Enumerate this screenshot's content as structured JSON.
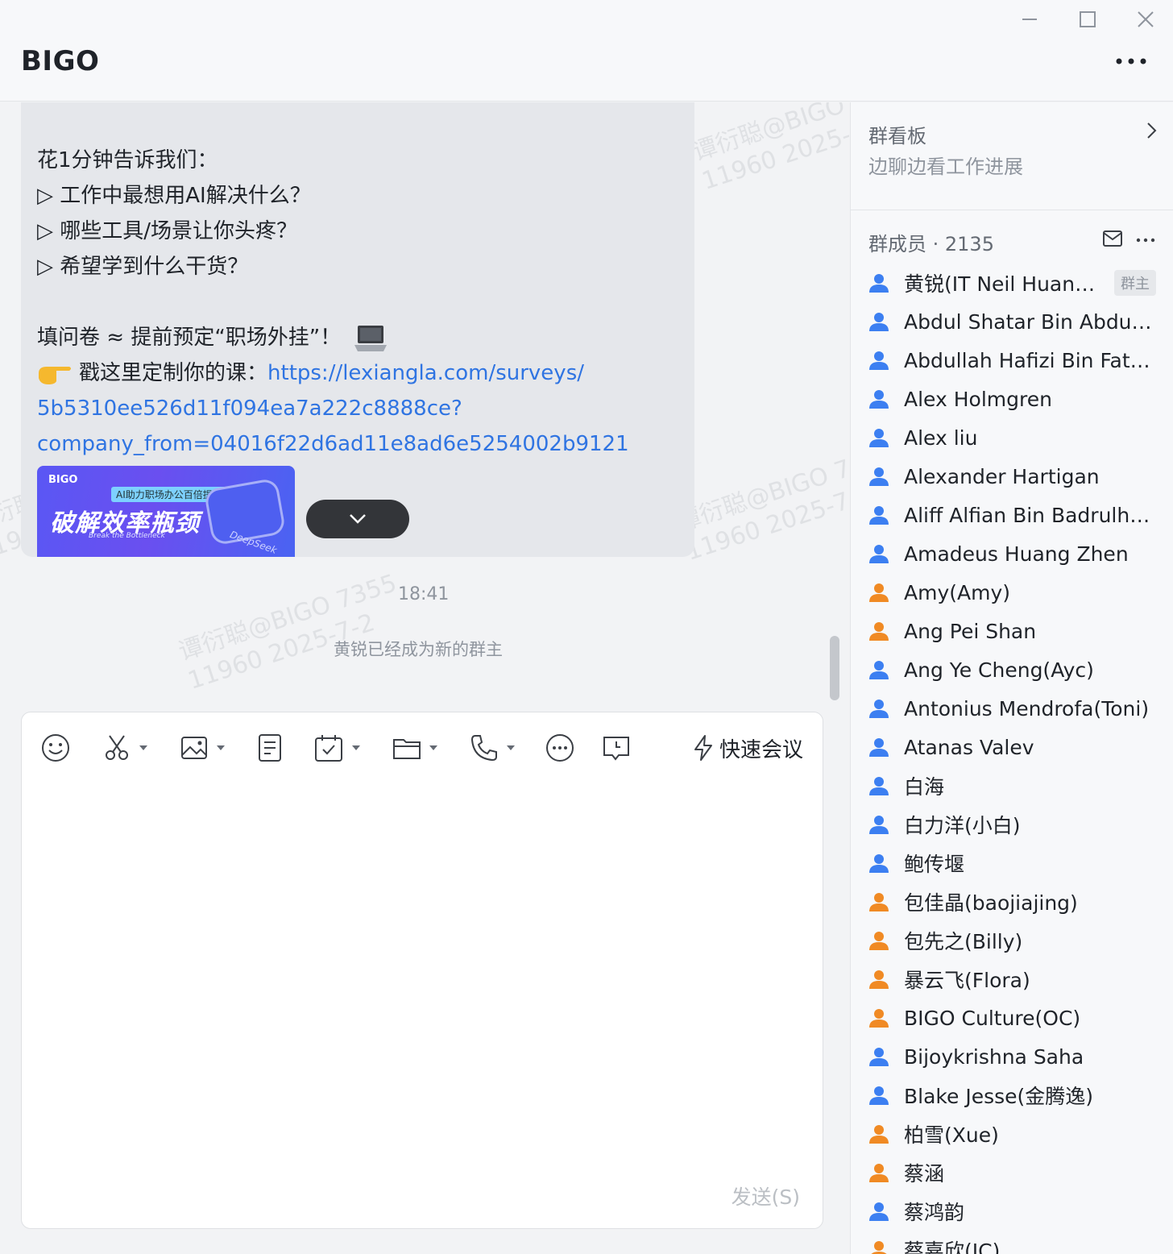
{
  "window": {
    "title": "BIGO"
  },
  "message": {
    "lines": [
      "花1分钟告诉我们：",
      "▷ 工作中最想用AI解决什么？",
      "▷ 哪些工具/场景让你头疼？",
      "▷ 希望学到什么干货？"
    ],
    "cta_line": "填问卷 ≈ 提前预定“职场外挂”！",
    "link_prefix": "戳这里定制你的课：",
    "link_part1": "https://lexiangla.com/surveys/",
    "link_part2": "5b5310ee526d11f094ea7a222c8888ce?",
    "link_part3": "company_from=04016f22d6ad11e8ad6e5254002b9121",
    "banner": {
      "logo": "BIGO",
      "tag": "AI助力职场办公百倍提效",
      "main": "破解效率瓶颈",
      "sub": "Break the Bottleneck",
      "brand": "DeepSeek"
    }
  },
  "timestamp": "18:41",
  "system_message": "黄锐已经成为新的群主",
  "watermarks": [
    "谭衍聪@BIGO 7355",
    "11960 2025-7-2"
  ],
  "composer": {
    "quick_meeting_label": "快速会议",
    "send_label": "发送(S)"
  },
  "panel": {
    "board_title": "群看板",
    "board_subtitle": "边聊边看工作进展",
    "members_header": "群成员 · 2135",
    "owner_tag": "群主",
    "members": [
      {
        "name": "黄锐(IT Neil Huang ...",
        "color": "#3c7ff1"
      },
      {
        "name": "Abdul Shatar Bin Abdul S...",
        "color": "#3c7ff1"
      },
      {
        "name": "Abdullah Hafizi Bin Fathil",
        "color": "#3c7ff1"
      },
      {
        "name": "Alex Holmgren",
        "color": "#3c7ff1"
      },
      {
        "name": "Alex liu",
        "color": "#3c7ff1"
      },
      {
        "name": "Alexander Hartigan",
        "color": "#3c7ff1"
      },
      {
        "name": "Aliff Alfian Bin Badrulhish...",
        "color": "#3c7ff1"
      },
      {
        "name": "Amadeus Huang Zhen",
        "color": "#3c7ff1"
      },
      {
        "name": "Amy(Amy)",
        "color": "#f08a24"
      },
      {
        "name": "Ang Pei Shan",
        "color": "#f08a24"
      },
      {
        "name": "Ang Ye Cheng(Ayc)",
        "color": "#3c7ff1"
      },
      {
        "name": "Antonius Mendrofa(Toni)",
        "color": "#3c7ff1"
      },
      {
        "name": "Atanas Valev",
        "color": "#3c7ff1"
      },
      {
        "name": "白海",
        "color": "#3c7ff1"
      },
      {
        "name": "白力洋(小白)",
        "color": "#3c7ff1"
      },
      {
        "name": "鲍传堰",
        "color": "#3c7ff1"
      },
      {
        "name": "包佳晶(baojiajing)",
        "color": "#f08a24"
      },
      {
        "name": "包先之(Billy)",
        "color": "#f08a24"
      },
      {
        "name": "暴云飞(Flora)",
        "color": "#f08a24"
      },
      {
        "name": "BIGO Culture(OC)",
        "color": "#f08a24"
      },
      {
        "name": "Bijoykrishna Saha",
        "color": "#3c7ff1"
      },
      {
        "name": "Blake Jesse(金腾逸)",
        "color": "#3c7ff1"
      },
      {
        "name": "柏雪(Xue)",
        "color": "#f08a24"
      },
      {
        "name": "蔡涵",
        "color": "#f08a24"
      },
      {
        "name": "蔡鸿韵",
        "color": "#3c7ff1"
      },
      {
        "name": "蔡嘉欣(JC)",
        "color": "#f08a24"
      }
    ]
  },
  "icons": {
    "toolbar": [
      "emoji-icon",
      "screenshot-icon",
      "image-icon",
      "doc-icon",
      "task-icon",
      "folder-icon",
      "phone-icon",
      "more-icon",
      "schedule-message-icon"
    ]
  }
}
